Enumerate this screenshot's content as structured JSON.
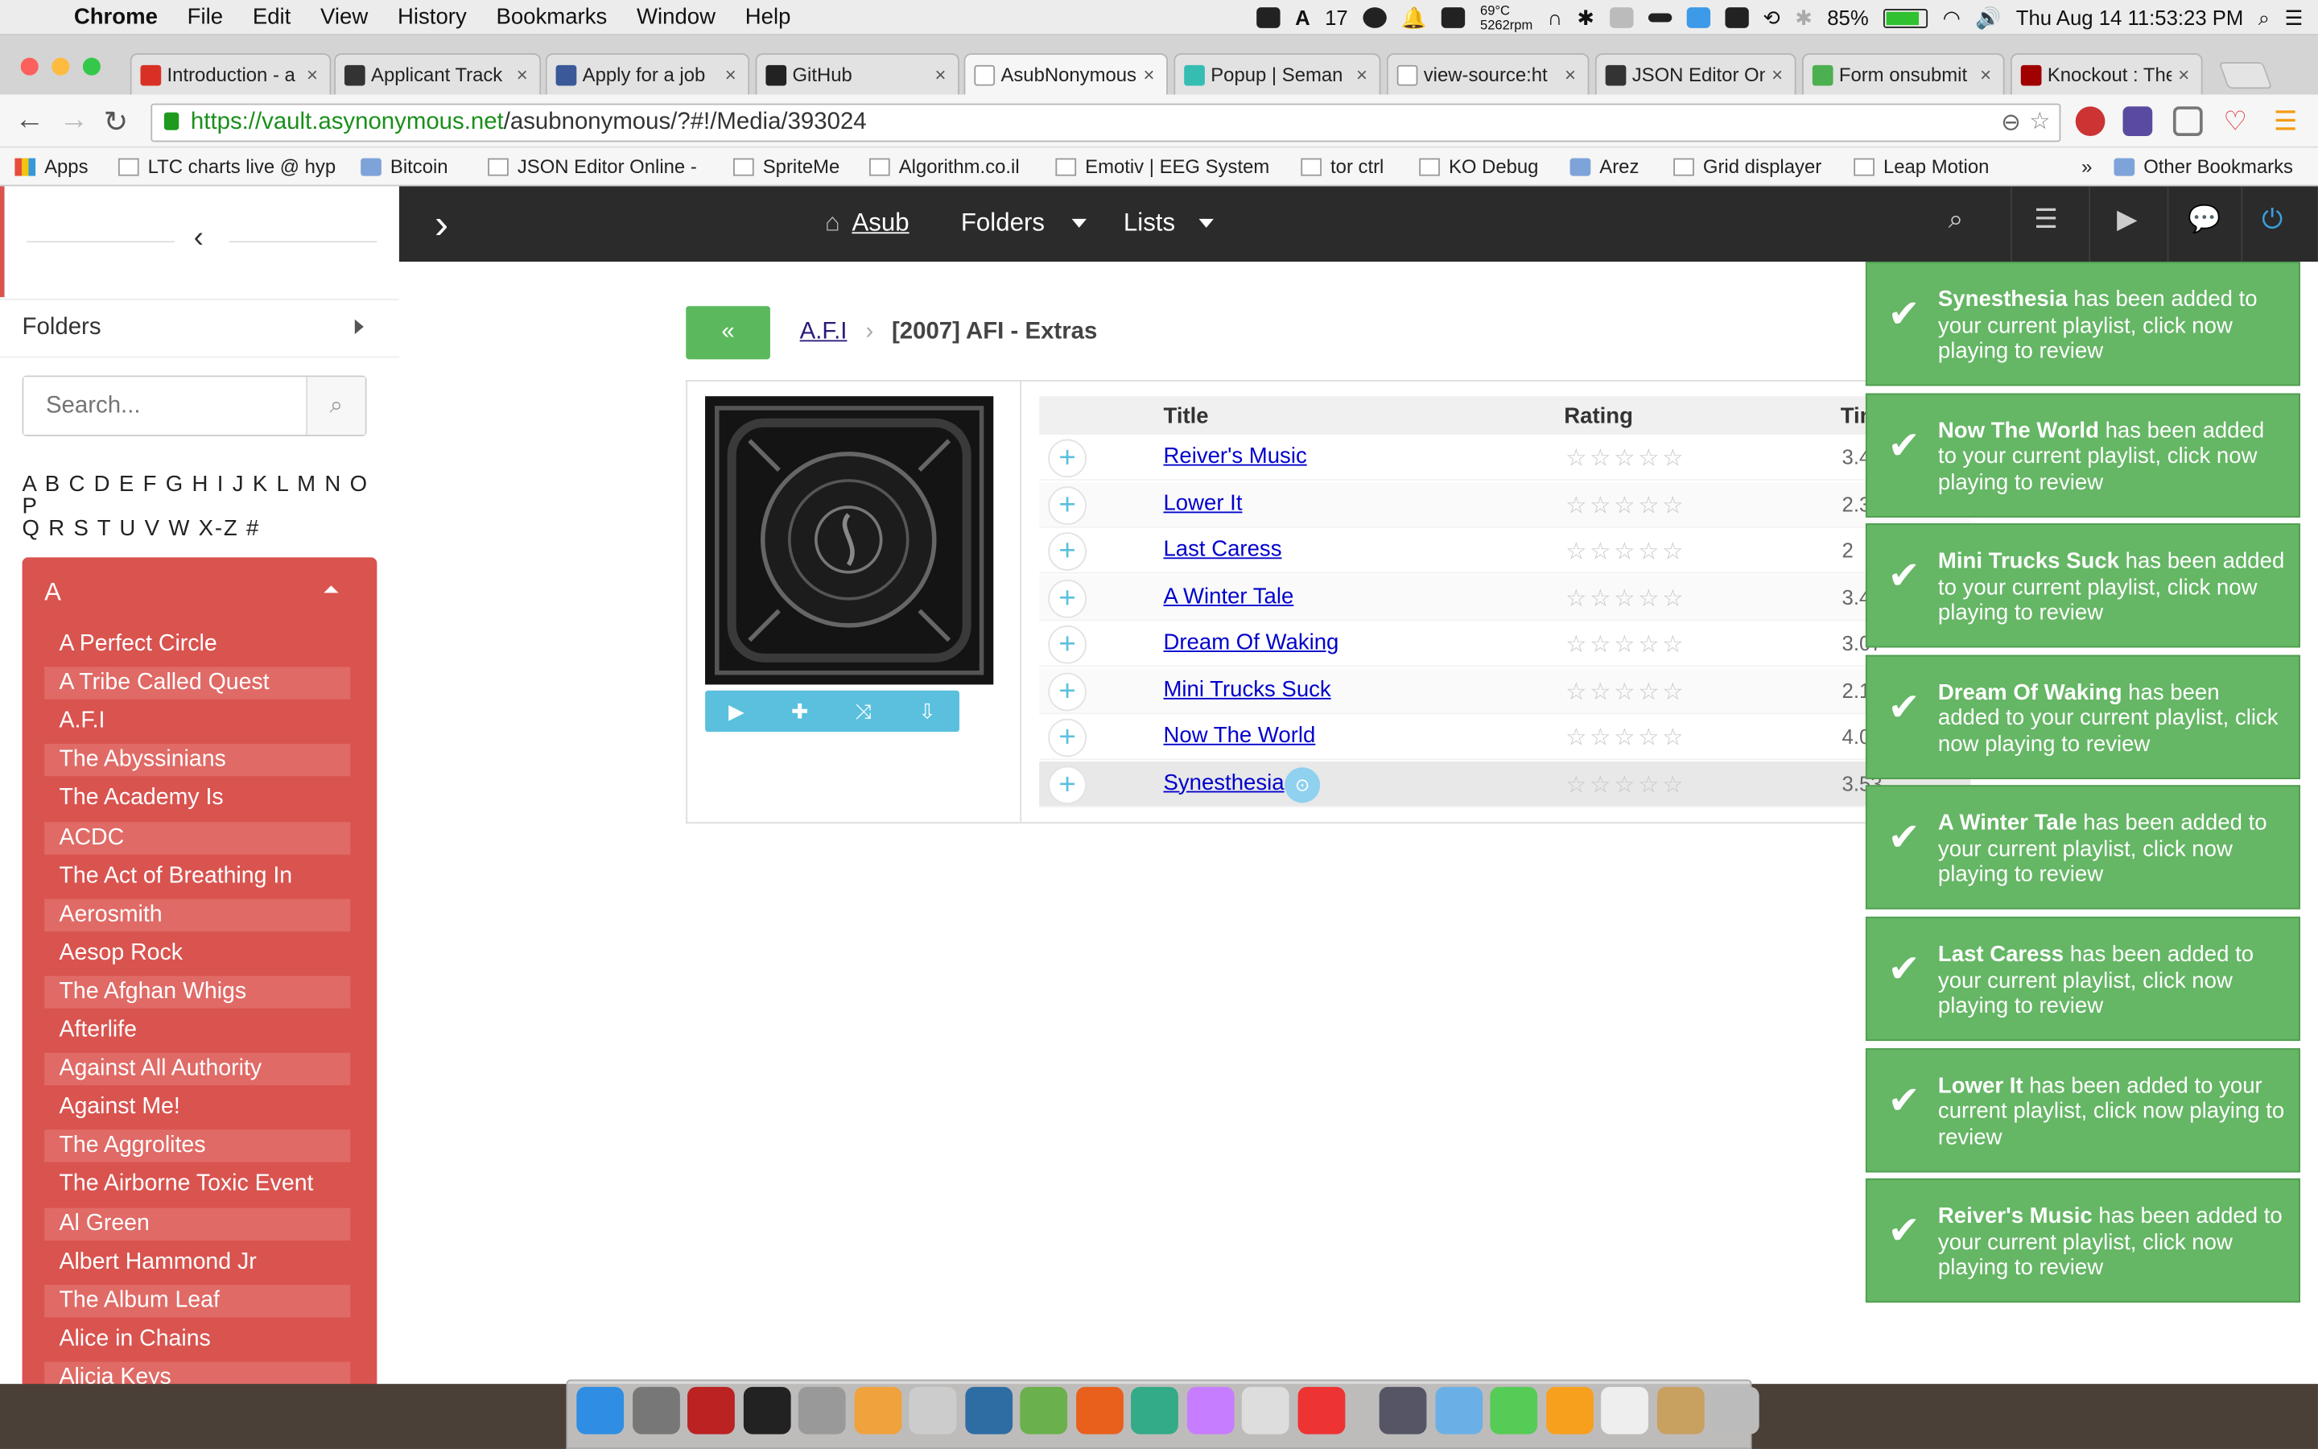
{
  "menubar": {
    "app": "Chrome",
    "items": [
      "File",
      "Edit",
      "View",
      "History",
      "Bookmarks",
      "Window",
      "Help"
    ],
    "tray": {
      "adobe_count": "17",
      "temp": "69°C",
      "rpm": "5262rpm",
      "battery": "85%",
      "battery_level": 0.85,
      "datetime": "Thu Aug 14  11:53:23 PM"
    }
  },
  "tabs": [
    {
      "label": "Introduction - a",
      "color": "#d93025"
    },
    {
      "label": "Applicant Track",
      "color": "#333333"
    },
    {
      "label": "Apply for a job",
      "color": "#3b5998"
    },
    {
      "label": "GitHub",
      "color": "#222222"
    },
    {
      "label": "AsubNonymous",
      "color": "#ffffff"
    },
    {
      "label": "Popup | Seman",
      "color": "#35bdb2"
    },
    {
      "label": "view-source:ht",
      "color": "#ffffff"
    },
    {
      "label": "JSON Editor On",
      "color": "#333333"
    },
    {
      "label": "Form onsubmit",
      "color": "#4caf50"
    },
    {
      "label": "Knockout : The",
      "color": "#a00000"
    }
  ],
  "toolbar": {
    "url_scheme_host": "https://vault.asynonymous.net",
    "url_path": "/asubnonymous/?#!/Media/393024"
  },
  "bookmarks": [
    {
      "label": "Apps",
      "type": "apps"
    },
    {
      "label": "LTC charts live @ hyp",
      "type": "page"
    },
    {
      "label": "Bitcoin",
      "type": "folder"
    },
    {
      "label": "JSON Editor Online -",
      "type": "page"
    },
    {
      "label": "SpriteMe",
      "type": "page"
    },
    {
      "label": "Algorithm.co.il",
      "type": "page"
    },
    {
      "label": "Emotiv | EEG System",
      "type": "page"
    },
    {
      "label": "tor ctrl",
      "type": "page"
    },
    {
      "label": "KO Debug",
      "type": "page"
    },
    {
      "label": "Arez",
      "type": "folder"
    },
    {
      "label": "Grid displayer",
      "type": "page"
    },
    {
      "label": "Leap Motion",
      "type": "page"
    },
    {
      "label": "»",
      "type": "more"
    },
    {
      "label": "Other Bookmarks",
      "type": "folder"
    }
  ],
  "nav": {
    "home": "Asub",
    "folders": "Folders",
    "lists": "Lists"
  },
  "sidebar": {
    "folders_label": "Folders",
    "search_placeholder": "Search...",
    "alphabet_line1": "A B C D E F G H I J K L M N O P",
    "alphabet_line2": "Q R S T U V W X-Z #",
    "letter": "A",
    "artists": [
      "A Perfect Circle",
      "A Tribe Called Quest",
      "A.F.I",
      "The Abyssinians",
      "The Academy Is",
      "ACDC",
      "The Act of Breathing In",
      "Aerosmith",
      "Aesop Rock",
      "The Afghan Whigs",
      "Afterlife",
      "Against All Authority",
      "Against Me!",
      "The Aggrolites",
      "The Airborne Toxic Event",
      "Al Green",
      "Albert Hammond Jr",
      "The Album Leaf",
      "Alice in Chains",
      "Alicia Keys"
    ]
  },
  "album": {
    "back_label": "«",
    "artist": "A.F.I",
    "title": "[2007] AFI - Extras",
    "columns": {
      "title": "Title",
      "rating": "Rating",
      "time": "Time"
    },
    "tracks": [
      {
        "title": "Reiver's Music",
        "time": "3.4",
        "rating": 0
      },
      {
        "title": "Lower It",
        "time": "2.35",
        "rating": 0
      },
      {
        "title": "Last Caress",
        "time": "2",
        "rating": 0
      },
      {
        "title": "A Winter Tale",
        "time": "3.43",
        "rating": 0
      },
      {
        "title": "Dream Of Waking",
        "time": "3.07",
        "rating": 0
      },
      {
        "title": "Mini Trucks Suck",
        "time": "2.17",
        "rating": 0
      },
      {
        "title": "Now The World",
        "time": "4.03",
        "rating": 0
      },
      {
        "title": "Synesthesia",
        "time": "3.53",
        "rating": 0
      }
    ]
  },
  "toasts": [
    {
      "song": "Synesthesia",
      "text": " has been added to your current playlist, click now playing to review"
    },
    {
      "song": "Now The World",
      "text": " has been added to your current playlist, click now playing to review"
    },
    {
      "song": "Mini Trucks Suck",
      "text": " has been added to your current playlist, click now playing to review"
    },
    {
      "song": "Dream Of Waking",
      "text": " has been added to your current playlist, click now playing to review"
    },
    {
      "song": "A Winter Tale",
      "text": " has been added to your current playlist, click now playing to review"
    },
    {
      "song": "Last Caress",
      "text": " has been added to your current playlist, click now playing to review"
    },
    {
      "song": "Lower It",
      "text": " has been added to your current playlist, click now playing to review"
    },
    {
      "song": "Reiver's Music",
      "text": " has been added to your current playlist, click now playing to review"
    }
  ],
  "dock_icons": [
    "finder-icon",
    "system-prefs-icon",
    "filezilla-icon",
    "terminal-icon",
    "gimp-icon",
    "ibooks-icon",
    "launchpad-icon",
    "mysql-workbench-icon",
    "leaf-icon",
    "firefox-icon",
    "chrome-icon",
    "octopus-icon",
    "sublime-icon",
    "itunes-icon",
    "user-icon",
    "folder-icon",
    "xmind-icon",
    "illustrator-icon",
    "document-icon",
    "box-icon",
    "trash-icon"
  ]
}
